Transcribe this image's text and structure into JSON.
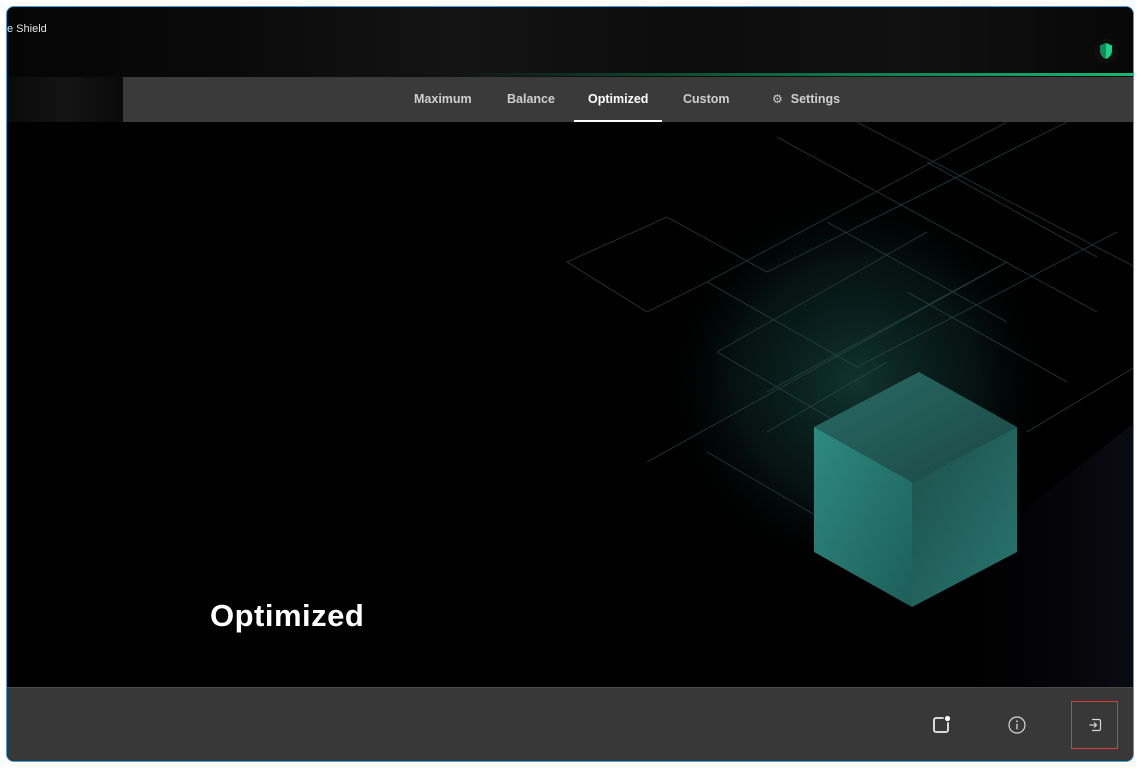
{
  "window": {
    "title": "e Shield",
    "accent_color": "#18b876",
    "shield_icon": "shield-icon"
  },
  "nav": {
    "tabs": [
      {
        "label": "Maximum",
        "active": false
      },
      {
        "label": "Balance",
        "active": false
      },
      {
        "label": "Optimized",
        "active": true
      },
      {
        "label": "Custom",
        "active": false
      },
      {
        "label": "Settings",
        "active": false,
        "icon": "gear-icon"
      }
    ]
  },
  "hero": {
    "title": "Optimized",
    "cube_color": "#2f7f7a"
  },
  "footer": {
    "buttons": [
      {
        "icon": "notification-badge-icon"
      },
      {
        "icon": "info-icon"
      },
      {
        "icon": "exit-icon",
        "highlighted": true
      }
    ]
  }
}
